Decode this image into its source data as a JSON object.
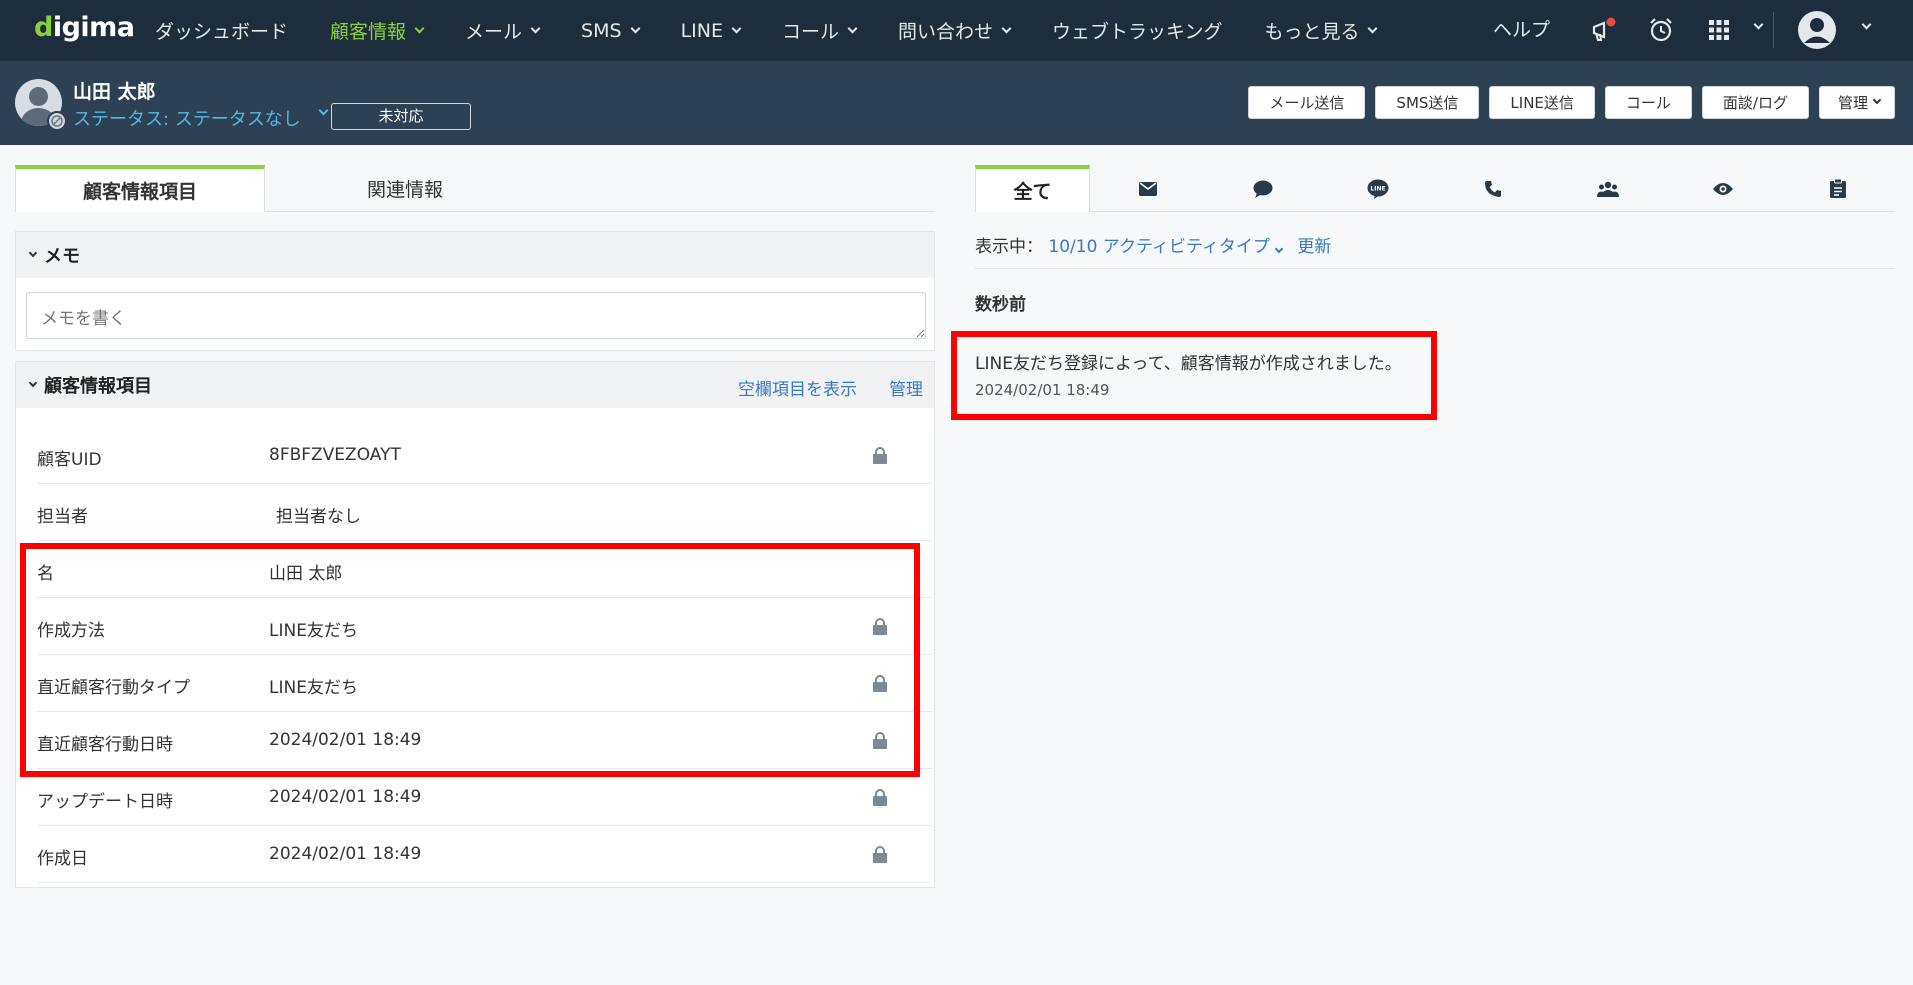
{
  "app": {
    "logo": "digima"
  },
  "nav": {
    "items": [
      {
        "label": "ダッシュボード",
        "dropdown": false
      },
      {
        "label": "顧客情報",
        "dropdown": true,
        "active": true
      },
      {
        "label": "メール",
        "dropdown": true
      },
      {
        "label": "SMS",
        "dropdown": true
      },
      {
        "label": "LINE",
        "dropdown": true
      },
      {
        "label": "コール",
        "dropdown": true
      },
      {
        "label": "問い合わせ",
        "dropdown": true
      },
      {
        "label": "ウェブトラッキング",
        "dropdown": false
      },
      {
        "label": "もっと見る",
        "dropdown": true
      }
    ],
    "help": "ヘルプ",
    "icons": [
      "megaphone-icon",
      "alarm-clock-icon",
      "apps-grid-icon",
      "user-avatar-icon"
    ]
  },
  "customer": {
    "name": "山田 太郎",
    "status": "ステータス: ステータスなし",
    "response_status": "未対応",
    "actions": [
      "メール送信",
      "SMS送信",
      "LINE送信",
      "コール",
      "面談/ログ",
      "管理"
    ]
  },
  "left": {
    "tabs": [
      "顧客情報項目",
      "関連情報"
    ],
    "memo": {
      "title": "メモ",
      "placeholder": "メモを書く"
    },
    "info": {
      "title": "顧客情報項目",
      "show_empty": "空欄項目を表示",
      "manage": "管理",
      "rows": [
        {
          "label": "顧客UID",
          "value": "8FBFZVEZOAYT",
          "locked": true
        },
        {
          "label": "担当者",
          "value": "担当者なし",
          "locked": false
        },
        {
          "label": "名",
          "value": "山田 太郎",
          "locked": false
        },
        {
          "label": "作成方法",
          "value": "LINE友だち",
          "locked": true
        },
        {
          "label": "直近顧客行動タイプ",
          "value": "LINE友だち",
          "locked": true
        },
        {
          "label": "直近顧客行動日時",
          "value": "2024/02/01 18:49",
          "locked": true
        },
        {
          "label": "アップデート日時",
          "value": "2024/02/01 18:49",
          "locked": true
        },
        {
          "label": "作成日",
          "value": "2024/02/01 18:49",
          "locked": true
        }
      ]
    }
  },
  "right": {
    "tabs": {
      "all": "全て",
      "icons": [
        "mail-icon",
        "chat-bubble-icon",
        "line-icon",
        "phone-icon",
        "group-icon",
        "eye-icon",
        "clipboard-icon"
      ]
    },
    "filter": {
      "prefix": "表示中：",
      "selection": "10/10 アクティビティタイプ",
      "refresh": "更新"
    },
    "timeline": {
      "group": "数秒前",
      "entries": [
        {
          "text": "LINE友だち登録によって、顧客情報が作成されました。",
          "time": "2024/02/01 18:49"
        }
      ]
    }
  },
  "colors": {
    "nav_bg": "#1e2d3b",
    "accent_green": "#8bd03a",
    "link_blue": "#3979c0",
    "highlight_red": "#ff0000"
  }
}
